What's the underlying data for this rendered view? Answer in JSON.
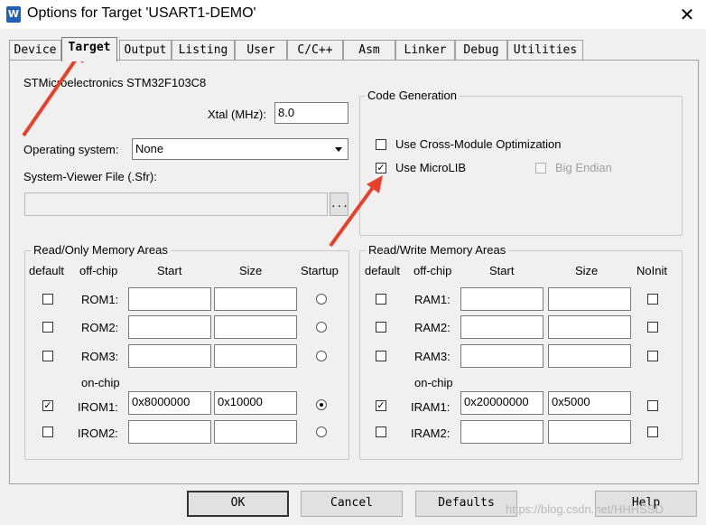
{
  "window": {
    "title": "Options for Target 'USART1-DEMO'",
    "close_glyph": "✕",
    "icon_letter": "W"
  },
  "tabs": [
    "Device",
    "Target",
    "Output",
    "Listing",
    "User",
    "C/C++",
    "Asm",
    "Linker",
    "Debug",
    "Utilities"
  ],
  "active_tab": "Target",
  "target": {
    "device": "STMicroelectronics STM32F103C8",
    "xtal_label": "Xtal (MHz):",
    "xtal_value": "8.0",
    "os_label": "Operating system:",
    "os_value": "None",
    "svf_label": "System-Viewer File (.Sfr):",
    "svf_value": "",
    "browse_label": "..."
  },
  "code_generation": {
    "title": "Code Generation",
    "cross_module": {
      "label": "Use Cross-Module Optimization",
      "checked": false
    },
    "microlib": {
      "label": "Use MicroLIB",
      "checked": true
    },
    "big_endian": {
      "label": "Big Endian",
      "checked": false,
      "enabled": false
    }
  },
  "ro_memory": {
    "title": "Read/Only Memory Areas",
    "headers": {
      "default": "default",
      "offchip": "off-chip",
      "start": "Start",
      "size": "Size",
      "startup": "Startup"
    },
    "onchip_label": "on-chip",
    "rows": [
      {
        "name": "ROM1:",
        "default": false,
        "start": "",
        "size": "",
        "startup": false
      },
      {
        "name": "ROM2:",
        "default": false,
        "start": "",
        "size": "",
        "startup": false
      },
      {
        "name": "ROM3:",
        "default": false,
        "start": "",
        "size": "",
        "startup": false
      },
      {
        "name": "IROM1:",
        "default": true,
        "start": "0x8000000",
        "size": "0x10000",
        "startup": true
      },
      {
        "name": "IROM2:",
        "default": false,
        "start": "",
        "size": "",
        "startup": false
      }
    ]
  },
  "rw_memory": {
    "title": "Read/Write Memory Areas",
    "headers": {
      "default": "default",
      "offchip": "off-chip",
      "start": "Start",
      "size": "Size",
      "noinit": "NoInit"
    },
    "onchip_label": "on-chip",
    "rows": [
      {
        "name": "RAM1:",
        "default": false,
        "start": "",
        "size": "",
        "noinit": false
      },
      {
        "name": "RAM2:",
        "default": false,
        "start": "",
        "size": "",
        "noinit": false
      },
      {
        "name": "RAM3:",
        "default": false,
        "start": "",
        "size": "",
        "noinit": false
      },
      {
        "name": "IRAM1:",
        "default": true,
        "start": "0x20000000",
        "size": "0x5000",
        "noinit": false
      },
      {
        "name": "IRAM2:",
        "default": false,
        "start": "",
        "size": "",
        "noinit": false
      }
    ]
  },
  "buttons": {
    "ok": "OK",
    "cancel": "Cancel",
    "defaults": "Defaults",
    "help": "Help"
  },
  "watermark": "https://blog.csdn.net/HHHSSD",
  "colors": {
    "annotation_arrow": "#e8402a",
    "title_icon": "#1f5fb8"
  }
}
